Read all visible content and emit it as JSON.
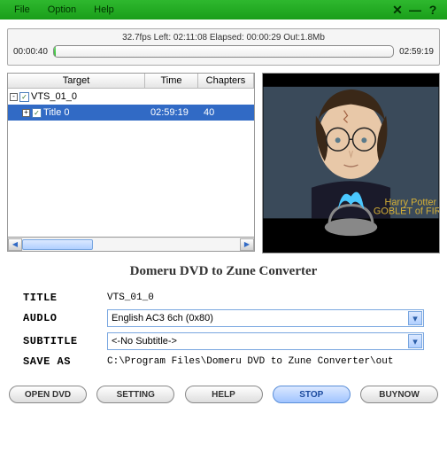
{
  "menubar": {
    "file": "File",
    "option": "Option",
    "help": "Help"
  },
  "progress": {
    "info": "32.7fps Left: 02:11:08 Elapsed: 00:00:29 Out:1.8Mb",
    "start": "00:00:40",
    "end": "02:59:19"
  },
  "list": {
    "headers": {
      "target": "Target",
      "time": "Time",
      "chapters": "Chapters"
    },
    "rows": [
      {
        "name": "VTS_01_0",
        "time": "",
        "chapters": "",
        "level": 0,
        "expander": "-",
        "selected": false
      },
      {
        "name": "Title 0",
        "time": "02:59:19",
        "chapters": "40",
        "level": 1,
        "expander": "+",
        "selected": true
      }
    ]
  },
  "app_title": "Domeru DVD to Zune Converter",
  "form": {
    "title_lbl": "TITLE",
    "title_val": "VTS_01_0",
    "audio_lbl": "AUDLO",
    "audio_val": "English AC3 6ch (0x80)",
    "subtitle_lbl": "SUBTITLE",
    "subtitle_val": "<-No Subtitle->",
    "saveas_lbl": "SAVE AS",
    "saveas_val": "C:\\Program Files\\Domeru DVD to Zune Converter\\out"
  },
  "buttons": {
    "open": "OPEN DVD",
    "setting": "SETTING",
    "help": "HELP",
    "stop": "STOP",
    "buynow": "BUYNOW"
  }
}
